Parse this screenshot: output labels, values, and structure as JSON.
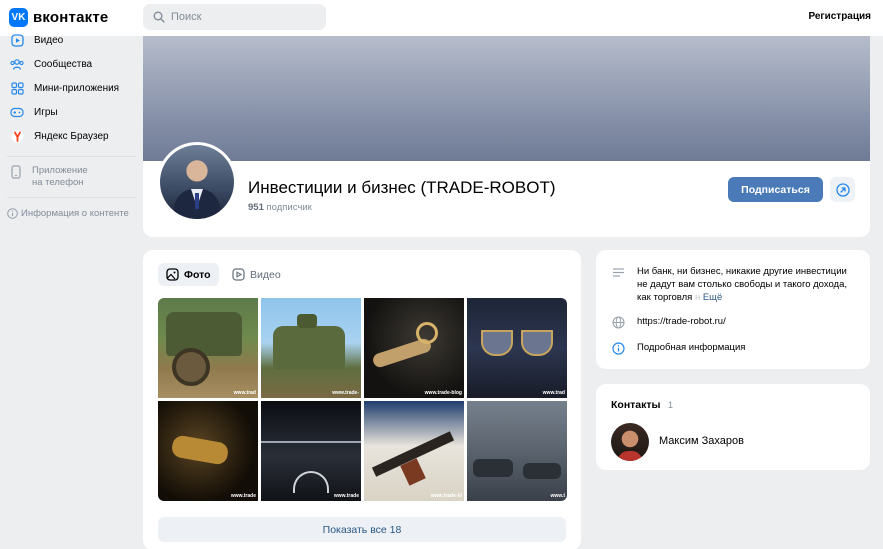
{
  "header": {
    "logo_badge": "VK",
    "logo_text": "вконтакте",
    "search_placeholder": "Поиск",
    "register_label": "Регистрация"
  },
  "sidebar": {
    "items": [
      {
        "label": "Видео",
        "icon": "video-icon"
      },
      {
        "label": "Сообщества",
        "icon": "communities-icon"
      },
      {
        "label": "Мини-приложения",
        "icon": "mini-apps-icon"
      },
      {
        "label": "Игры",
        "icon": "gamepad-icon"
      },
      {
        "label": "Яндекс Браузер",
        "icon": "yandex-icon"
      }
    ],
    "app_label": "Приложение\nна телефон",
    "info_label": "Информация о контенте"
  },
  "profile": {
    "title": "Инвестиции и бизнес (TRADE-ROBOT)",
    "subscribers_count": "951",
    "subscribers_label": "подписчик",
    "subscribe_label": "Подписаться"
  },
  "media": {
    "tabs": [
      {
        "label": "Фото",
        "icon": "photo-icon",
        "active": true
      },
      {
        "label": "Видео",
        "icon": "video-play-icon",
        "active": false
      }
    ],
    "photos": [
      {
        "watermark": "www.trad"
      },
      {
        "watermark": "www.trade-"
      },
      {
        "watermark": "www.trade-blog"
      },
      {
        "watermark": "www.trad"
      },
      {
        "watermark": "www.trade"
      },
      {
        "watermark": "www.trade"
      },
      {
        "watermark": "www.trade-bl"
      },
      {
        "watermark": "www.t"
      }
    ],
    "show_all_label": "Показать все 18"
  },
  "info": {
    "description": "Ни банк, ни бизнес, никакие другие инвестиции не дадут вам столько свободы и такого дохода, как торговля",
    "description_fade": " н",
    "more_label": "Ещё",
    "link": "https://trade-robot.ru/",
    "details_label": "Подробная информация"
  },
  "contacts": {
    "title": "Контакты",
    "count": "1",
    "items": [
      {
        "name": "Максим Захаров"
      }
    ]
  },
  "colors": {
    "accent": "#4a7ab8",
    "link": "#2a5885",
    "vk_blue": "#0077ff",
    "background": "#edeef0"
  }
}
